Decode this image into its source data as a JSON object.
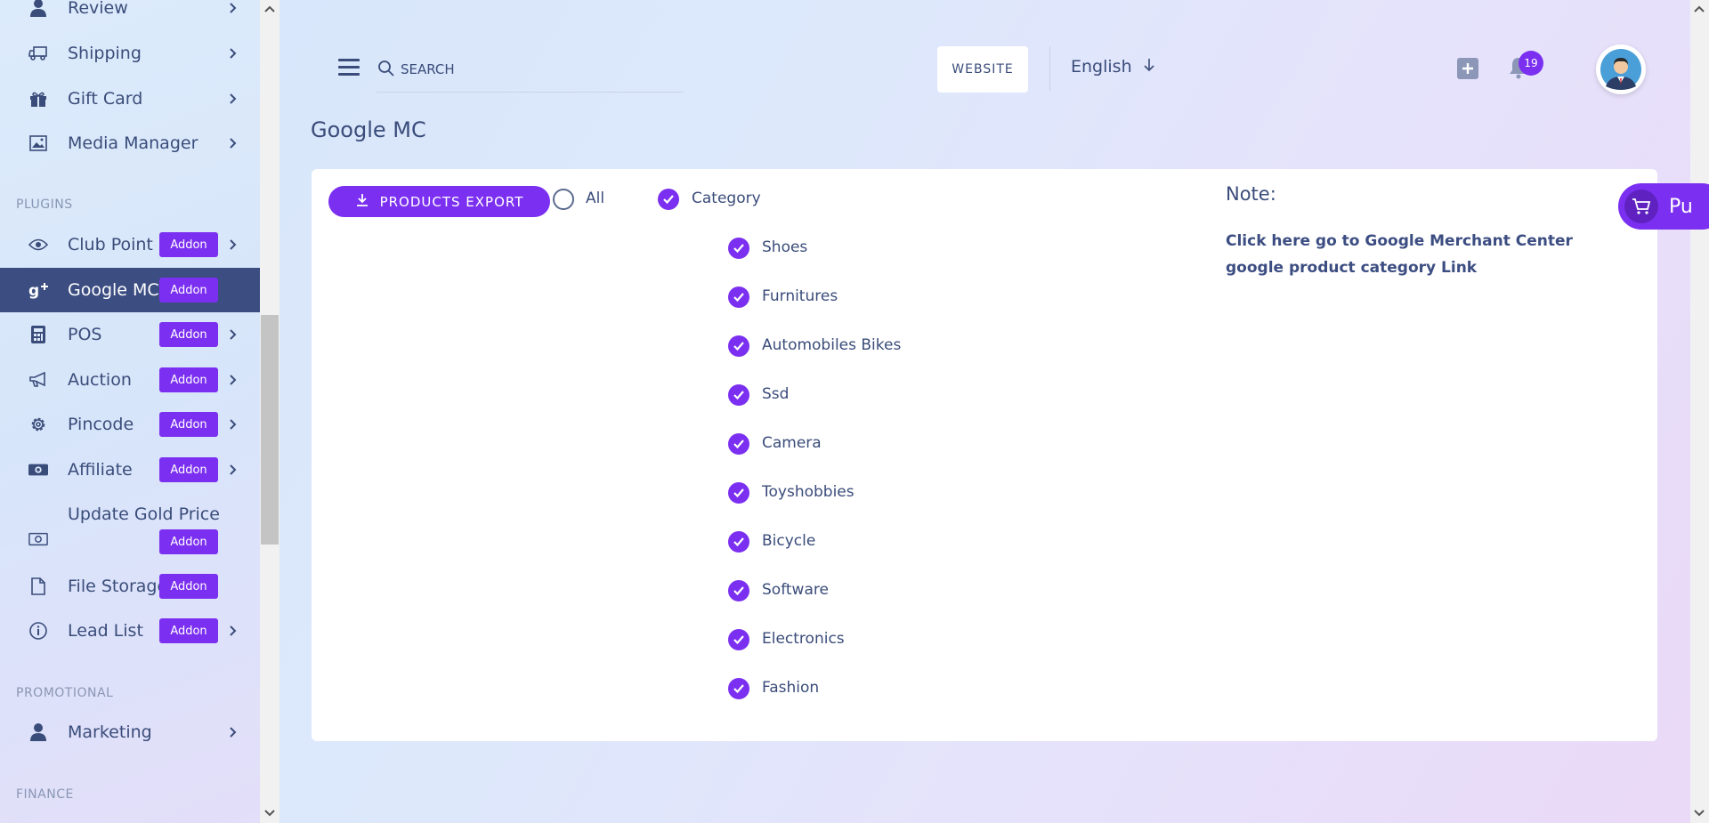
{
  "sidebar": {
    "top_items": [
      {
        "label": "Review",
        "icon": "user-icon"
      },
      {
        "label": "Shipping",
        "icon": "truck-icon"
      },
      {
        "label": "Gift Card",
        "icon": "gift-icon"
      },
      {
        "label": "Media Manager",
        "icon": "image-icon"
      }
    ],
    "plugins_label": "PLUGINS",
    "plugin_items": [
      {
        "label": "Club Point",
        "icon": "eye-icon",
        "addon": "Addon"
      },
      {
        "label": "Google MC",
        "icon": "google-plus-icon",
        "addon": "Addon"
      },
      {
        "label": "POS",
        "icon": "calculator-icon",
        "addon": "Addon"
      },
      {
        "label": "Auction",
        "icon": "megaphone-icon",
        "addon": "Addon"
      },
      {
        "label": "Pincode",
        "icon": "gear-icon",
        "addon": "Addon"
      },
      {
        "label": "Affiliate",
        "icon": "money-icon",
        "addon": "Addon"
      },
      {
        "label": "Update Gold Price",
        "icon": "money-bill-icon",
        "addon": "Addon"
      },
      {
        "label": "File Storage",
        "icon": "file-icon",
        "addon": "Addon"
      },
      {
        "label": "Lead List",
        "icon": "info-icon",
        "addon": "Addon"
      }
    ],
    "promotional_label": "PROMOTIONAL",
    "promotional_items": [
      {
        "label": "Marketing",
        "icon": "user-icon"
      }
    ],
    "finance_label": "FINANCE"
  },
  "header": {
    "search_placeholder": "SEARCH",
    "website_label": "WEBSITE",
    "language": "English",
    "notification_count": "19"
  },
  "page": {
    "title": "Google MC"
  },
  "card": {
    "export_label": "PRODUCTS EXPORT",
    "all_label": "All",
    "category_label": "Category",
    "categories": [
      "Shoes",
      "Furnitures",
      "Automobiles Bikes",
      "Ssd",
      "Camera",
      "Toyshobbies",
      "Bicycle",
      "Software",
      "Electronics",
      "Fashion"
    ],
    "note_title": "Note:",
    "note_link": "Click here go to Google Merchant Center google product category Link"
  },
  "floating": {
    "label": "Pu"
  },
  "colors": {
    "accent": "#7b2ff0",
    "active_sidebar": "#3c4d82",
    "text": "#3a4c7a"
  }
}
